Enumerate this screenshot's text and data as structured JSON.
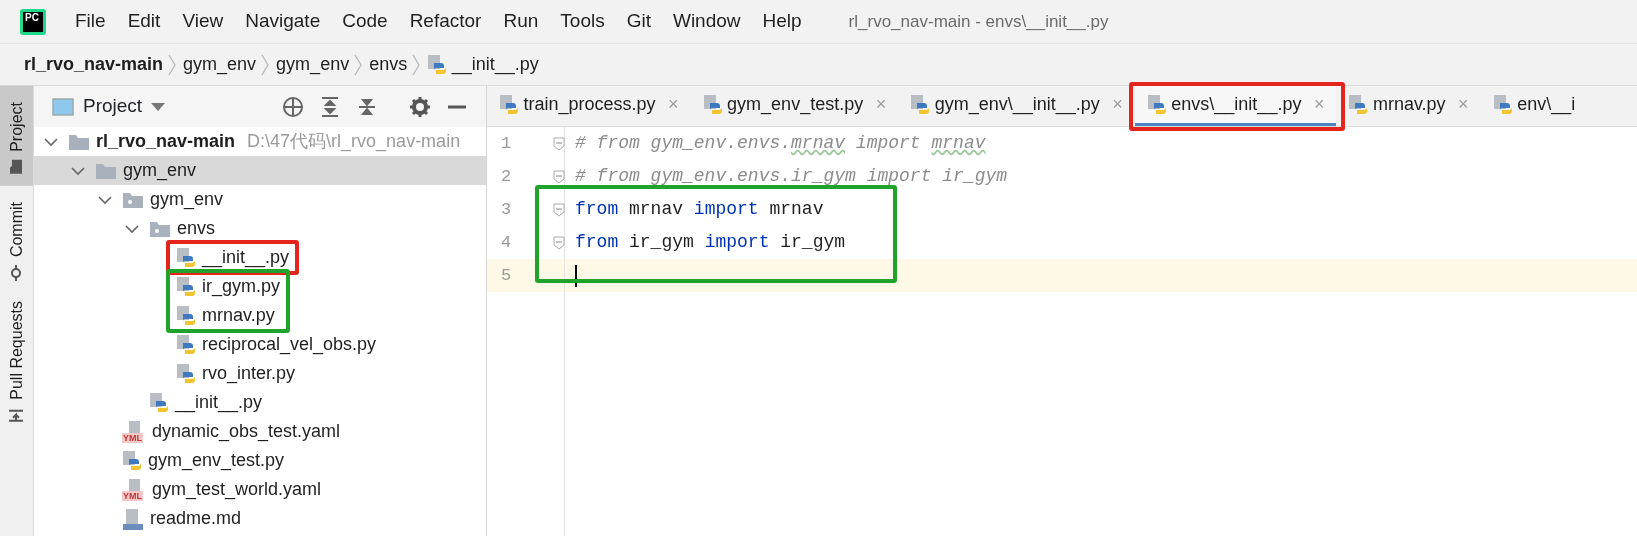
{
  "window": {
    "app_logo": "PC",
    "title": "rl_rvo_nav-main - envs\\__init__.py"
  },
  "menu": [
    {
      "label": "File"
    },
    {
      "label": "Edit"
    },
    {
      "label": "View"
    },
    {
      "label": "Navigate"
    },
    {
      "label": "Code"
    },
    {
      "label": "Refactor"
    },
    {
      "label": "Run"
    },
    {
      "label": "Tools"
    },
    {
      "label": "Git"
    },
    {
      "label": "Window"
    },
    {
      "label": "Help"
    }
  ],
  "breadcrumbs": [
    {
      "label": "rl_rvo_nav-main",
      "kind": "project"
    },
    {
      "label": "gym_env",
      "kind": "folder"
    },
    {
      "label": "gym_env",
      "kind": "folder"
    },
    {
      "label": "envs",
      "kind": "folder"
    },
    {
      "label": "__init__.py",
      "kind": "python"
    }
  ],
  "tool_strip": [
    {
      "label": "Project",
      "kind": "project",
      "selected": true
    },
    {
      "label": "Commit",
      "kind": "commit",
      "selected": false
    },
    {
      "label": "Pull Requests",
      "kind": "pull",
      "selected": false
    }
  ],
  "project_panel": {
    "title": "Project",
    "tree": [
      {
        "label": "rl_rvo_nav-main",
        "kind": "project",
        "path": "D:\\47代码\\rl_rvo_nav-main",
        "selected": false,
        "expanded": true,
        "children": [
          {
            "label": "gym_env",
            "kind": "folder",
            "selected": true,
            "expanded": true,
            "children": [
              {
                "label": "gym_env",
                "kind": "package",
                "selected": false,
                "expanded": true,
                "children": [
                  {
                    "label": "envs",
                    "kind": "package",
                    "selected": false,
                    "expanded": true,
                    "children": [
                      {
                        "label": "__init__.py",
                        "kind": "python",
                        "selected": false,
                        "color": "#e3251d"
                      },
                      {
                        "label": "ir_gym.py",
                        "kind": "python",
                        "selected": false,
                        "color": "#1fa32a"
                      },
                      {
                        "label": "mrnav.py",
                        "kind": "python",
                        "selected": false,
                        "color": "#1fa32a"
                      },
                      {
                        "label": "reciprocal_vel_obs.py",
                        "kind": "python",
                        "selected": false
                      },
                      {
                        "label": "rvo_inter.py",
                        "kind": "python",
                        "selected": false
                      }
                    ]
                  },
                  {
                    "label": "__init__.py",
                    "kind": "python",
                    "selected": false
                  }
                ]
              },
              {
                "label": "dynamic_obs_test.yaml",
                "kind": "yaml",
                "icon_text": "YML",
                "selected": false
              },
              {
                "label": "gym_env_test.py",
                "kind": "python",
                "selected": false
              },
              {
                "label": "gym_test_world.yaml",
                "kind": "yaml",
                "icon_text": "YML",
                "selected": false
              },
              {
                "label": "readme.md",
                "kind": "markdown",
                "selected": false
              }
            ]
          }
        ]
      }
    ]
  },
  "editor": {
    "tabs": [
      {
        "label": "train_process.py",
        "close": "×",
        "selected": false
      },
      {
        "label": "gym_env_test.py",
        "close": "×",
        "selected": false
      },
      {
        "label": "gym_env\\__init__.py",
        "close": "×",
        "selected": false
      },
      {
        "label": "envs\\__init__.py",
        "close": "×",
        "selected": true,
        "color": "#e3251d"
      },
      {
        "label": "mrnav.py",
        "close": "×",
        "selected": false
      },
      {
        "label": "env\\__i",
        "selected": false
      }
    ],
    "lines": [
      {
        "number": "1",
        "fold": true,
        "current": false,
        "tokens": [
          {
            "kind": "comment",
            "text": "# from gym_env.envs."
          },
          {
            "kind": "comment",
            "text": "mrnav",
            "typo": true
          },
          {
            "kind": "comment",
            "text": " import "
          },
          {
            "kind": "comment",
            "text": "mrnav",
            "typo": true
          }
        ]
      },
      {
        "number": "2",
        "fold": true,
        "current": false,
        "tokens": [
          {
            "kind": "comment",
            "text": "# from gym_env.envs.ir_gym import ir_gym"
          }
        ]
      },
      {
        "number": "3",
        "fold": true,
        "current": false,
        "color": "#1fa32a",
        "tokens": [
          {
            "kind": "keyword",
            "text": "from"
          },
          {
            "kind": "name",
            "text": " mrnav "
          },
          {
            "kind": "keyword",
            "text": "import"
          },
          {
            "kind": "name",
            "text": " mrnav"
          }
        ]
      },
      {
        "number": "4",
        "fold": true,
        "current": false,
        "color": "#1fa32a",
        "tokens": [
          {
            "kind": "keyword",
            "text": "from"
          },
          {
            "kind": "name",
            "text": " ir_gym "
          },
          {
            "kind": "keyword",
            "text": "import"
          },
          {
            "kind": "name",
            "text": " ir_gym"
          }
        ]
      },
      {
        "number": "5",
        "fold": false,
        "current": true,
        "caret": true
      }
    ]
  }
}
